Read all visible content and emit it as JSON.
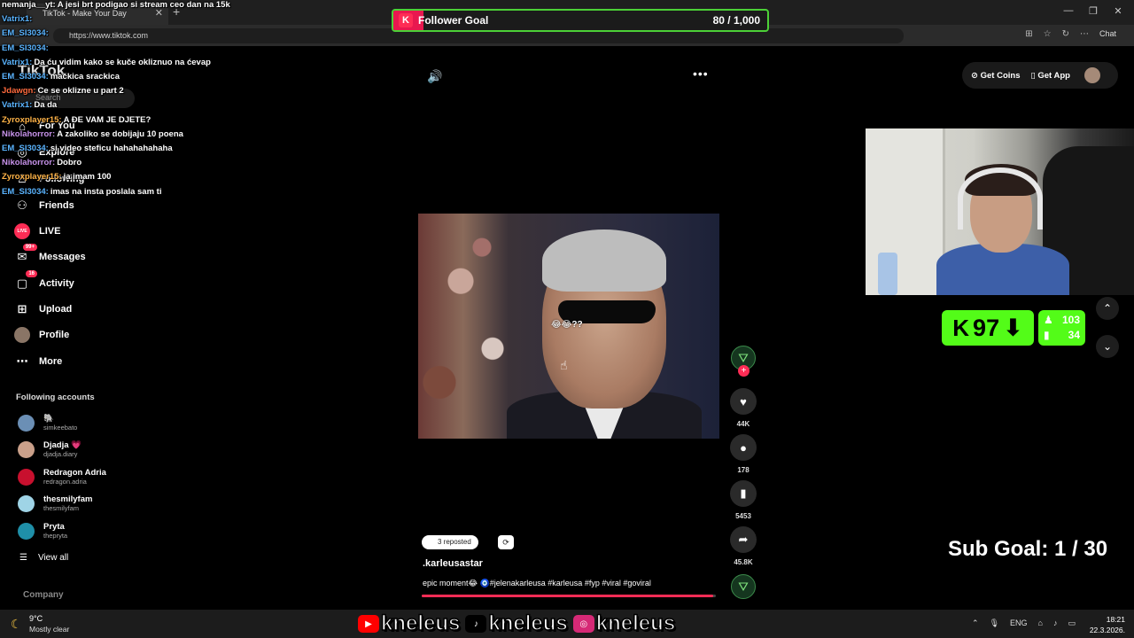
{
  "browser": {
    "tab_title": "TikTok - Make Your Day",
    "url": "https://www.tiktok.com",
    "chat_label": "Chat"
  },
  "chat": [
    {
      "user": "nemanja__yt:",
      "msg": "A jesi brt podigao si stream ceo dan na 15k",
      "color": "#ffffff"
    },
    {
      "user": "Vatrix1:",
      "msg": "",
      "color": "#5ab4ff"
    },
    {
      "user": "EM_SI3034:",
      "msg": "",
      "color": "#5ab4ff"
    },
    {
      "user": "EM_SI3034:",
      "msg": "",
      "color": "#5ab4ff"
    },
    {
      "user": "Vatrix1:",
      "msg": "Da ću vidim kako se kuče okliznuo na ćevap",
      "color": "#5ab4ff"
    },
    {
      "user": "EM_SI3034:",
      "msg": "mačkica srackica",
      "color": "#5ab4ff"
    },
    {
      "user": "Jdawgn:",
      "msg": "Ce se oklizne u part 2",
      "color": "#ff6a3d"
    },
    {
      "user": "Vatrix1:",
      "msg": "Da da",
      "color": "#5ab4ff"
    },
    {
      "user": "Zyroxplayer15:",
      "msg": "A ĐE VAM JE DJETE?",
      "color": "#ffb347"
    },
    {
      "user": "Nikolahorror:",
      "msg": "A zakoliko se dobijaju 10 poena",
      "color": "#c792ea"
    },
    {
      "user": "EM_SI3034:",
      "msg": "si video steficu hahahahahaha",
      "color": "#5ab4ff"
    },
    {
      "user": "Nikolahorror:",
      "msg": "Dobro",
      "color": "#c792ea"
    },
    {
      "user": "Zyroxplayer15:",
      "msg": "ja imam 100",
      "color": "#ffb347"
    },
    {
      "user": "EM_SI3034:",
      "msg": "imas na insta poslala sam ti",
      "color": "#5ab4ff"
    }
  ],
  "goal": {
    "title": "Follower Goal",
    "count": "80 / 1,000",
    "current": 80,
    "target": 1000,
    "color": "#4cd137"
  },
  "sidebar": {
    "logo": "TikTok",
    "search_placeholder": "Search",
    "nav": [
      {
        "label": "For You",
        "icon": "home-icon"
      },
      {
        "label": "Explore",
        "icon": "compass-icon"
      },
      {
        "label": "Following",
        "icon": "following-icon"
      },
      {
        "label": "Friends",
        "icon": "friends-icon"
      },
      {
        "label": "LIVE",
        "icon": "live-icon"
      },
      {
        "label": "Messages",
        "icon": "messages-icon",
        "badge": "99+"
      },
      {
        "label": "Activity",
        "icon": "activity-icon",
        "badge": "16"
      },
      {
        "label": "Upload",
        "icon": "upload-icon"
      },
      {
        "label": "Profile",
        "icon": "profile-icon"
      },
      {
        "label": "More",
        "icon": "more-icon"
      }
    ],
    "following_title": "Following accounts",
    "accounts": [
      {
        "name": "🐘",
        "handle": "simkeebato",
        "color": "#6b8fb5"
      },
      {
        "name": "Djadja 💗",
        "handle": "djadja.diary",
        "color": "#caa08a"
      },
      {
        "name": "Redragon Adria",
        "handle": "redragon.adria",
        "color": "#c8102e"
      },
      {
        "name": "thesmilyfam",
        "handle": "thesmilyfam",
        "color": "#9fd4e6"
      },
      {
        "name": "Pryta",
        "handle": "thepryta",
        "color": "#1f8fa8"
      }
    ],
    "view_all": "View all",
    "company": "Company"
  },
  "video": {
    "caption_overlay": "😂😂??",
    "likes": "44K",
    "comments": "178",
    "saves": "5453",
    "shares": "45.8K",
    "repost_label": "3 reposted",
    "author": ".karleusastar",
    "description": "epic moment😂 🧿#jelenakarleusa #karleusa #fyp #viral #goviral",
    "progress": 0.99
  },
  "tiktok_top": {
    "get_coins": "Get Coins",
    "get_app": "Get App"
  },
  "kick": {
    "count": "97",
    "stat1": "103",
    "stat2": "34",
    "color": "#53fc18"
  },
  "sub_goal": {
    "label": "Sub Goal:",
    "value": "1 / 30"
  },
  "socials": [
    {
      "platform": "youtube",
      "name": "kneleus"
    },
    {
      "platform": "tiktok",
      "name": "kneleus"
    },
    {
      "platform": "instagram",
      "name": "kneleus"
    }
  ],
  "taskbar": {
    "temp": "9°C",
    "weather": "Mostly clear",
    "lang": "ENG",
    "time": "18:21",
    "date": "22.3.2026."
  }
}
